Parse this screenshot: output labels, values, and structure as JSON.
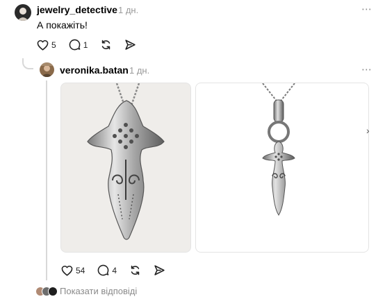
{
  "post": {
    "username": "jewelry_detective",
    "time": "1 дн.",
    "text": "А покажіть!",
    "likes": "5",
    "replies": "1"
  },
  "reply": {
    "username": "veronika.batan",
    "time": "1 дн.",
    "likes": "54",
    "replies": "4",
    "images": [
      {
        "icon": "silver-goddess-pendant-closeup"
      },
      {
        "icon": "silver-goddess-pendant-on-ring"
      }
    ]
  },
  "footer": {
    "show_replies": "Показати відповіді"
  },
  "icons": {
    "more": "⋯",
    "next": "›"
  },
  "colors": {
    "muted": "#9a9a9a",
    "thread_line": "#d8d8d8",
    "photo_bg": "#efedea"
  }
}
